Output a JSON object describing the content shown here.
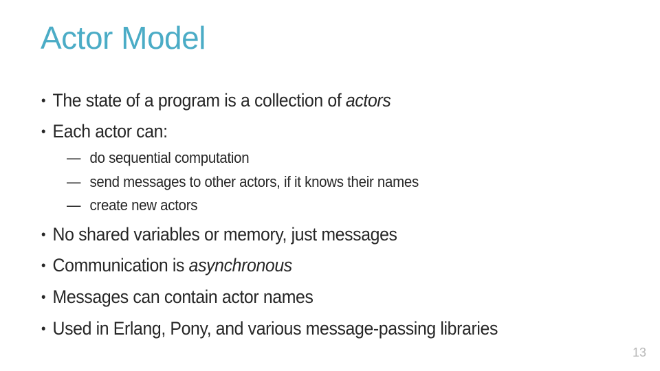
{
  "slide": {
    "title": "Actor Model",
    "title_color": "#4bacc6",
    "bullets": [
      {
        "pre": "The state of a program is a collection of ",
        "em": "actors",
        "post": ""
      },
      {
        "pre": "Each actor can:",
        "em": "",
        "post": ""
      }
    ],
    "sub_bullets": [
      "do sequential computation",
      "send messages to other actors, if it knows their names",
      "create new actors"
    ],
    "bullets_lower": [
      {
        "pre": "No shared variables or memory, just messages",
        "em": "",
        "post": ""
      },
      {
        "pre": "Communication is ",
        "em": "asynchronous",
        "post": ""
      },
      {
        "pre": "Messages can contain actor names",
        "em": "",
        "post": ""
      },
      {
        "pre": "Used in Erlang, Pony, and various message-passing libraries",
        "em": "",
        "post": ""
      }
    ],
    "bullet_glyph": "•",
    "dash_glyph": "—",
    "page_number": "13"
  }
}
